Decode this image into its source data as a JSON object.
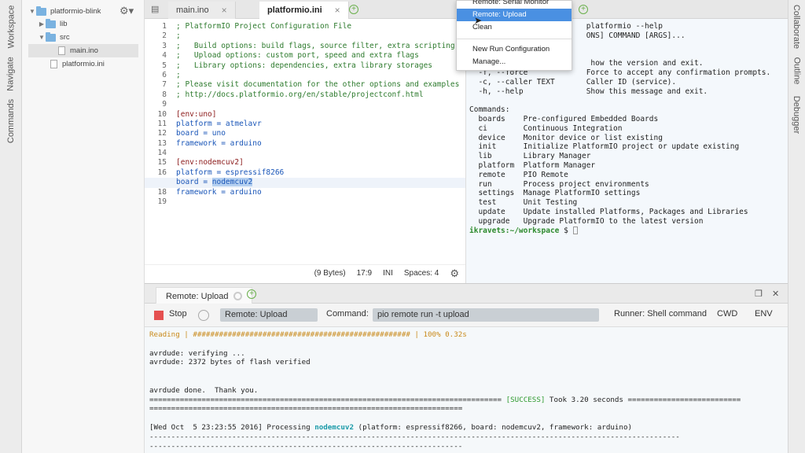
{
  "side_tabs": {
    "workspace": "Workspace",
    "navigate": "Navigate",
    "commands": "Commands"
  },
  "right_tabs": {
    "collaborate": "Collaborate",
    "outline": "Outline",
    "debugger": "Debugger"
  },
  "tree": {
    "project": "platformio-blink",
    "lib": "lib",
    "src": "src",
    "main_ino": "main.ino",
    "platformio_ini": "platformio.ini"
  },
  "editor_tabs": [
    {
      "label": "main.ino"
    },
    {
      "label": "platformio.ini"
    }
  ],
  "code_lines": [
    "; PlatformIO Project Configuration File",
    ";",
    ";   Build options: build flags, source filter, extra scripting",
    ";   Upload options: custom port, speed and extra flags",
    ";   Library options: dependencies, extra library storages",
    ";",
    "; Please visit documentation for the other options and examples",
    "; http://docs.platformio.org/en/stable/projectconf.html",
    "",
    "[env:uno]",
    "platform = atmelavr",
    "board = uno",
    "framework = arduino",
    "",
    "[env:nodemcuv2]",
    "platform = espressif8266",
    "board = nodemcuv2",
    "framework = arduino",
    ""
  ],
  "line_numbers": [
    "1",
    "2",
    "3",
    "4",
    "5",
    "6",
    "7",
    "8",
    "9",
    "10",
    "11",
    "12",
    "13",
    "14",
    "15",
    "16",
    "17",
    "18",
    "19"
  ],
  "status": {
    "size": "(9 Bytes)",
    "position": "17:9",
    "mode": "INI",
    "spaces": "Spaces: 4"
  },
  "terminal": {
    "lines": [
      "                          platformio --help",
      "                          ONS] COMMAND [ARGS]...",
      "",
      "",
      "                           how the version and exit.",
      "  -f, --force             Force to accept any confirmation prompts.",
      "  -c, --caller TEXT       Caller ID (service).",
      "  -h, --help              Show this message and exit.",
      "",
      "Commands:",
      "  boards    Pre-configured Embedded Boards",
      "  ci        Continuous Integration",
      "  device    Monitor device or list existing",
      "  init      Initialize PlatformIO project or update existing",
      "  lib       Library Manager",
      "  platform  Platform Manager",
      "  remote    PIO Remote",
      "  run       Process project environments",
      "  settings  Manage PlatformIO settings",
      "  test      Unit Testing",
      "  update    Update installed Platforms, Packages and Libraries",
      "  upgrade   Upgrade PlatformIO to the latest version"
    ],
    "prompt": "ikravets:~/workspace",
    "prompt_suffix": " $ "
  },
  "menu": {
    "items": [
      "Remote: Serial Monitor",
      "Remote: Upload",
      "Clean",
      "New Run Configuration",
      "Manage..."
    ]
  },
  "bottom_panel": {
    "tab_label": "Remote: Upload",
    "stop": "Stop",
    "run_name": "Remote: Upload",
    "command_label": "Command:",
    "command_value": "pio remote run -t upload",
    "runner": "Runner: Shell command",
    "cwd": "CWD",
    "env": "ENV"
  },
  "output": {
    "reading": "Reading | ################################################## | 100% 0.32s",
    "l1": "avrdude: verifying ...",
    "l2": "avrdude: 2372 bytes of flash verified",
    "l3": "avrdude done.  Thank you.",
    "sep_left": "=================================================================================",
    "success": "[SUCCESS]",
    "took": " Took 3.20 seconds ",
    "sep_right": "==========================",
    "sep_line": "========================================================================",
    "processing_pre": "[Wed Oct  5 23:23:55 2016] Processing ",
    "processing_env": "nodemcuv2",
    "processing_post": " (platform: espressif8266, board: nodemcuv2, framework: arduino)",
    "dash_line": "--------------------------------------------------------------------------------------------------------------------------",
    "dash_line2": "------------------------------------------------------------------------"
  },
  "colors": {
    "accent": "#4a90e2",
    "success": "#2e9a2e",
    "stop": "#e55050",
    "plus": "#6ab04c"
  }
}
